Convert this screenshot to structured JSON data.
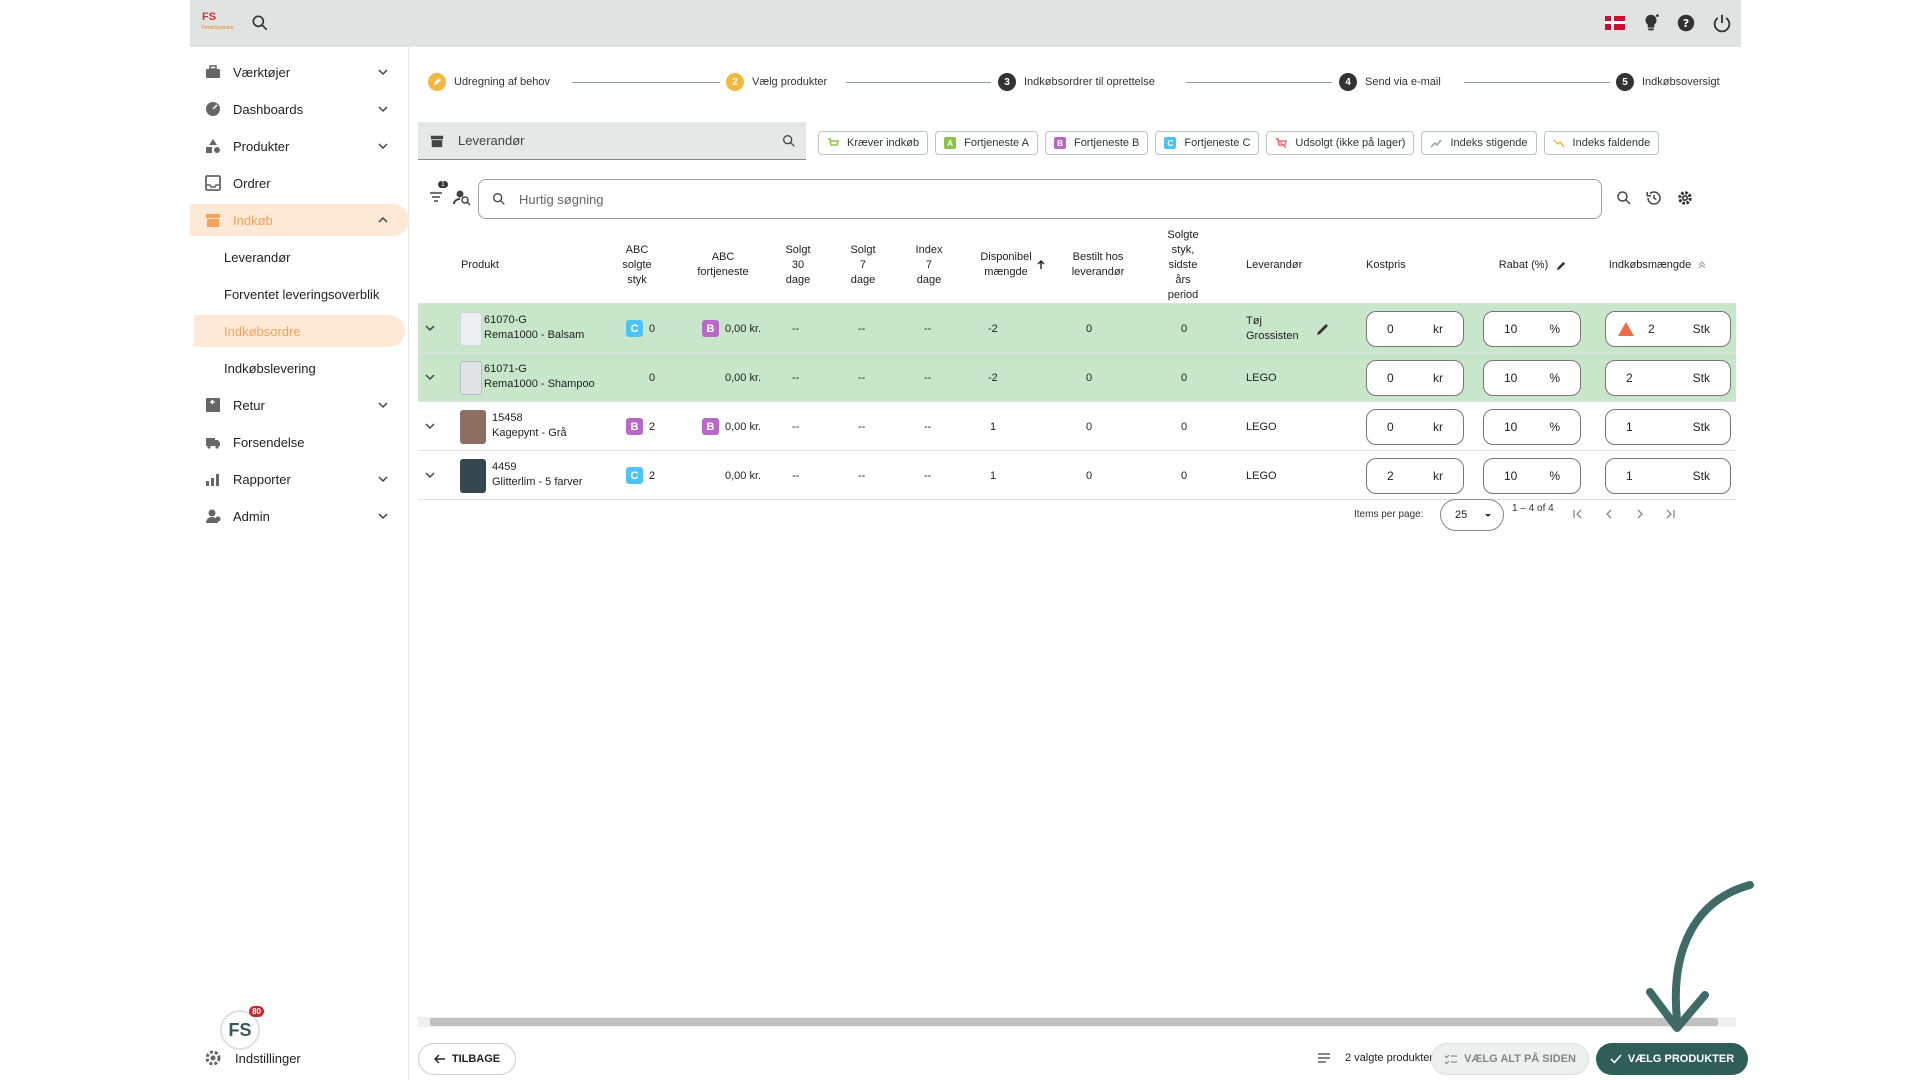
{
  "brand": {
    "logo_text": "FS",
    "logo_sub": "FenixSystems"
  },
  "colors": {
    "accent": "#f4a259",
    "brand_dark": "#2f5d57",
    "row_highlight": "#c8e6c9",
    "abc_a": "#8bc34a",
    "abc_b": "#ba68c8",
    "abc_c": "#4fc3f7"
  },
  "topbar": {
    "icons": [
      "search-icon",
      "flag-dk-icon",
      "lightbulb-icon",
      "help-icon",
      "power-icon"
    ]
  },
  "sidebar": {
    "items": [
      {
        "label": "Værktøjer",
        "icon": "toolbox-icon",
        "expandable": true
      },
      {
        "label": "Dashboards",
        "icon": "gauge-icon",
        "expandable": true
      },
      {
        "label": "Produkter",
        "icon": "shapes-icon",
        "expandable": true
      },
      {
        "label": "Ordrer",
        "icon": "inbox-icon",
        "expandable": false
      },
      {
        "label": "Indkøb",
        "icon": "store-icon",
        "expandable": true,
        "active": true
      },
      {
        "label": "Retur",
        "icon": "return-icon",
        "expandable": true
      },
      {
        "label": "Forsendelse",
        "icon": "truck-icon",
        "expandable": false
      },
      {
        "label": "Rapporter",
        "icon": "chart-icon",
        "expandable": true
      },
      {
        "label": "Admin",
        "icon": "admin-icon",
        "expandable": true
      }
    ],
    "subitems": [
      {
        "label": "Leverandør"
      },
      {
        "label": "Forventet leveringsoverblik"
      },
      {
        "label": "Indkøbsordre",
        "active": true
      },
      {
        "label": "Indkøbslevering"
      }
    ],
    "badge_text": "FS",
    "badge_count": "80",
    "settings_label": "Indstillinger"
  },
  "stepper": [
    {
      "num": "",
      "label": "Udregning af behov",
      "state": "done"
    },
    {
      "num": "2",
      "label": "Vælg produkter",
      "state": "active"
    },
    {
      "num": "3",
      "label": "Indkøbsordrer til oprettelse",
      "state": "todo"
    },
    {
      "num": "4",
      "label": "Send via e-mail",
      "state": "todo"
    },
    {
      "num": "5",
      "label": "Indkøbsoversigt",
      "state": "todo"
    }
  ],
  "supplier_select": {
    "label": "Leverandør"
  },
  "chips": [
    {
      "label": "Kræver indkøb",
      "icon": "cart-icon",
      "badge": "",
      "color": "#8bc34a"
    },
    {
      "label": "Fortjeneste A",
      "icon": "",
      "badge": "A",
      "color": "#8bc34a"
    },
    {
      "label": "Fortjeneste B",
      "icon": "",
      "badge": "B",
      "color": "#ba68c8"
    },
    {
      "label": "Fortjeneste C",
      "icon": "",
      "badge": "C",
      "color": "#4fc3f7"
    },
    {
      "label": "Udsolgt (ikke på lager)",
      "icon": "cart-off-icon",
      "badge": "",
      "color": "#e57373"
    },
    {
      "label": "Indeks stigende",
      "icon": "trend-up-icon",
      "badge": "",
      "color": "#90a4ae"
    },
    {
      "label": "Indeks faldende",
      "icon": "trend-down-icon",
      "badge": "",
      "color": "#ffb74d"
    }
  ],
  "filter_count": "1",
  "quick_search": {
    "placeholder": "Hurtig søgning"
  },
  "table": {
    "headers": {
      "product": "Produkt",
      "abc_sold": "ABC\nsolgte\nstyk",
      "abc_profit": "ABC\nfortjeneste",
      "sold30": "Solgt\n30\ndage",
      "sold7": "Solgt\n7\ndage",
      "index7": "Index\n7\ndage",
      "available": "Disponibel\nmængde",
      "ordered": "Bestilt hos\nleverandør",
      "sold_last_year": "Solgte\nstyk,\nsidste\nårs\nperiod",
      "supplier": "Leverandør",
      "cost": "Kostpris",
      "discount": "Rabat (%)",
      "qty": "Indkøbsmængde"
    },
    "rows": [
      {
        "sku": "61070-G",
        "name": "Rema1000 - Balsam",
        "abc_sold": "C",
        "sold": "0",
        "abc_profit": "B",
        "profit": "0,00 kr.",
        "sold30": "--",
        "sold7": "--",
        "index7": "--",
        "available": "-2",
        "ordered": "0",
        "sold_last_year": "0",
        "supplier": "Tøj\nGrossisten",
        "supplier_editable": true,
        "cost": "0",
        "cost_unit": "kr",
        "discount": "10",
        "discount_unit": "%",
        "qty": "2",
        "qty_unit": "Stk",
        "warning": true,
        "highlight": true,
        "img_color": "#e9ecef"
      },
      {
        "sku": "61071-G",
        "name": "Rema1000 - Shampoo",
        "abc_sold": "",
        "sold": "0",
        "abc_profit": "",
        "profit": "0,00 kr.",
        "sold30": "--",
        "sold7": "--",
        "index7": "--",
        "available": "-2",
        "ordered": "0",
        "sold_last_year": "0",
        "supplier": "LEGO",
        "supplier_editable": false,
        "cost": "0",
        "cost_unit": "kr",
        "discount": "10",
        "discount_unit": "%",
        "qty": "2",
        "qty_unit": "Stk",
        "warning": false,
        "highlight": true,
        "img_color": "#d9dcdf"
      },
      {
        "sku": "15458",
        "name": "Kagepynt - Grå",
        "abc_sold": "B",
        "sold": "2",
        "abc_profit": "B",
        "profit": "0,00 kr.",
        "sold30": "--",
        "sold7": "--",
        "index7": "--",
        "available": "1",
        "ordered": "0",
        "sold_last_year": "0",
        "supplier": "LEGO",
        "supplier_editable": false,
        "cost": "0",
        "cost_unit": "kr",
        "discount": "10",
        "discount_unit": "%",
        "qty": "1",
        "qty_unit": "Stk",
        "warning": false,
        "highlight": false,
        "img_color": "#8d6e63"
      },
      {
        "sku": "4459",
        "name": "Glitterlim - 5 farver",
        "abc_sold": "C",
        "sold": "2",
        "abc_profit": "",
        "profit": "0,00 kr.",
        "sold30": "--",
        "sold7": "--",
        "index7": "--",
        "available": "1",
        "ordered": "0",
        "sold_last_year": "0",
        "supplier": "LEGO",
        "supplier_editable": false,
        "cost": "2",
        "cost_unit": "kr",
        "discount": "10",
        "discount_unit": "%",
        "qty": "1",
        "qty_unit": "Stk",
        "warning": false,
        "highlight": false,
        "img_color": "#37474f"
      }
    ]
  },
  "pagination": {
    "items_per_page_label": "Items per page:",
    "page_size": "25",
    "range": "1 – 4 of 4"
  },
  "footer": {
    "back_label": "TILBAGE",
    "selected_count": "2 valgte produkter",
    "select_all_label": "VÆLG ALT PÅ SIDEN",
    "select_label": "VÆLG PRODUKTER"
  }
}
